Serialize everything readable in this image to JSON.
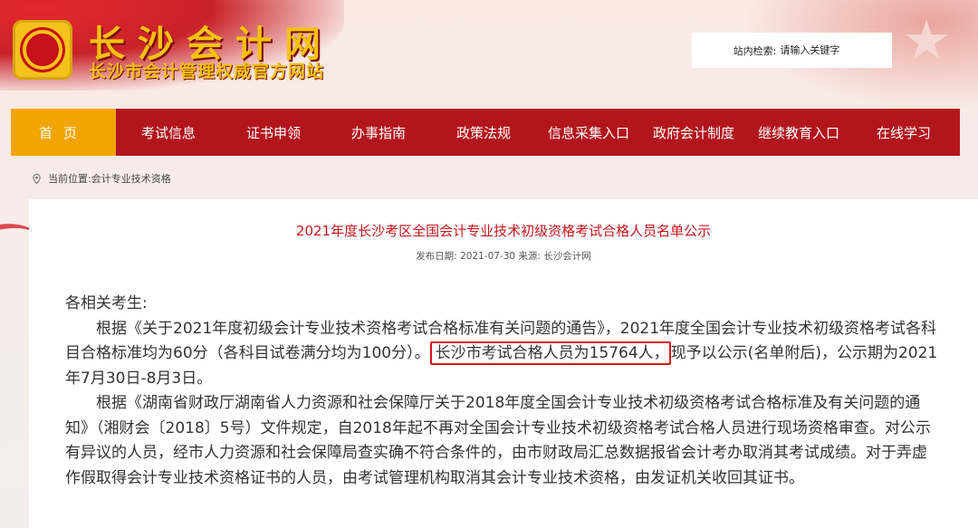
{
  "header": {
    "site_title": "长沙会计网",
    "site_subtitle": "长沙市会计管理权威官方网站",
    "search_label": "站内检索:",
    "search_placeholder": "请输入关键字"
  },
  "nav": {
    "items": [
      {
        "label": "首页",
        "active": true
      },
      {
        "label": "考试信息"
      },
      {
        "label": "证书申领"
      },
      {
        "label": "办事指南"
      },
      {
        "label": "政策法规"
      },
      {
        "label": "信息采集入口"
      },
      {
        "label": "政府会计制度"
      },
      {
        "label": "继续教育入口"
      },
      {
        "label": "在线学习"
      }
    ]
  },
  "breadcrumb": {
    "prefix": "当前位置:",
    "current": "会计专业技术资格"
  },
  "article": {
    "title": "2021年度长沙考区全国会计专业技术初级资格考试合格人员名单公示",
    "meta": "发布日期: 2021-07-30 来源: 长沙会计网",
    "greeting": "各相关考生:",
    "p1_before": "根据《关于2021年度初级会计专业技术资格考试合格标准有关问题的通告》，2021年度全国会计专业技术初级资格考试各科目合格标准均为60分（各科目试卷满分均为100分）。",
    "p1_highlight": "长沙市考试合格人员为15764人，",
    "p1_after": "现予以公示(名单附后)，公示期为2021年7月30日-8月3日。",
    "p2": "根据《湖南省财政厅湖南省人力资源和社会保障厅关于2018年度全国会计专业技术初级资格考试合格标准及有关问题的通知》（湘财会〔2018〕5号）文件规定，自2018年起不再对全国会计专业技术初级资格考试合格人员进行现场资格审查。对公示有异议的人员，经市人力资源和社会保障局查实确不符合条件的，由市财政局汇总数据报省会计考办取消其考试成绩。对于弄虚作假取得会计专业技术资格证书的人员，由考试管理机构取消其会计专业技术资格，由发证机关收回其证书。"
  },
  "colors": {
    "nav_bg": "#b3151d",
    "nav_active": "#f2a500",
    "title_red": "#c8161d",
    "logo_gold": "#f4c20d"
  }
}
